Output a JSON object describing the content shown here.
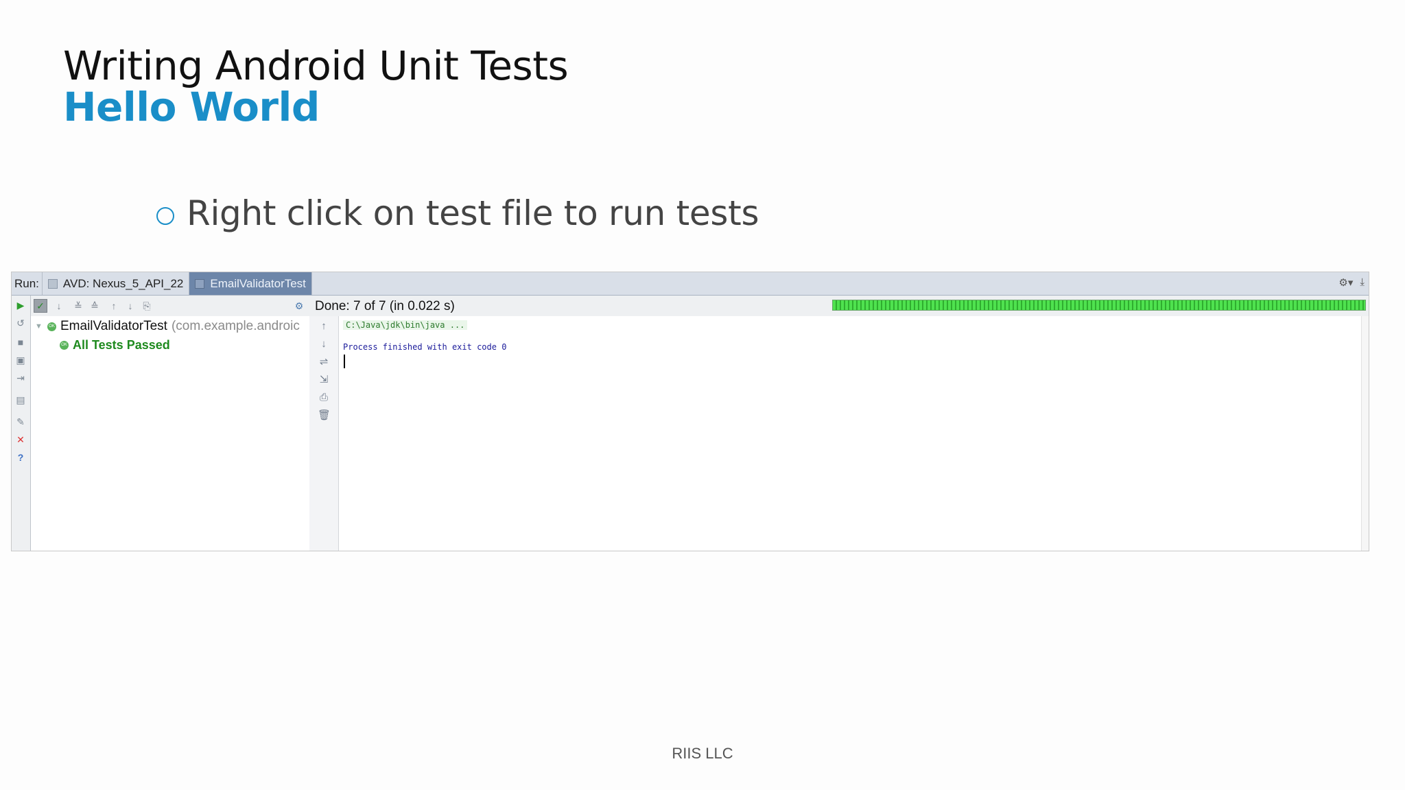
{
  "slide": {
    "title": "Writing Android Unit Tests",
    "subtitle": "Hello World",
    "bullet": "Right click on test file to run tests",
    "footer": "RIIS LLC"
  },
  "ide": {
    "run_label": "Run:",
    "tabs": [
      {
        "label": "AVD: Nexus_5_API_22",
        "active": false
      },
      {
        "label": "EmailValidatorTest",
        "active": true
      }
    ],
    "status_text": "Done: 7 of 7 (in 0.022 s)",
    "progress_fraction": 1.0,
    "tree": {
      "root_name": "EmailValidatorTest",
      "root_package": "(com.example.androic",
      "child_label": "All Tests Passed",
      "ok_badge": "OK"
    },
    "console": {
      "command_line": "C:\\Java\\jdk\\bin\\java ...",
      "exit_line": "Process finished with exit code 0"
    },
    "colors": {
      "accent_blue": "#1a8ec8",
      "pass_green": "#1e8a1e",
      "progress_green": "#3fd13f",
      "active_tab": "#6d86a9"
    },
    "icons": {
      "left_toolbar": [
        "run-icon",
        "rerun-icon",
        "stop-icon",
        "camera-icon",
        "import-icon",
        "layout-icon",
        "pin-icon",
        "close-icon",
        "help-icon"
      ],
      "tree_toolbar": [
        "toggle-passed-icon",
        "sort-alpha-icon",
        "expand-all-icon",
        "collapse-all-icon",
        "previous-icon",
        "next-icon",
        "export-icon",
        "settings-icon"
      ],
      "console_toolbar": [
        "scroll-up-icon",
        "scroll-down-icon",
        "soft-wrap-icon",
        "scroll-end-icon",
        "print-icon",
        "clear-icon"
      ]
    }
  }
}
